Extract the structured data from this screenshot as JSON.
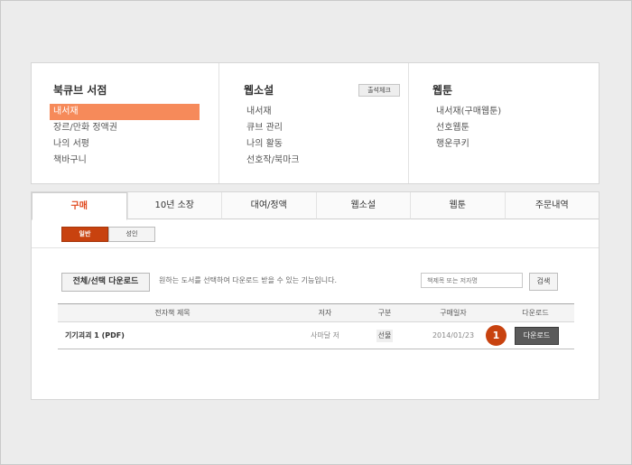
{
  "menu": {
    "bookstore": {
      "title": "북큐브 서점",
      "items": [
        "내서재",
        "장르/만화 정액권",
        "나의 서평",
        "책바구니"
      ]
    },
    "webnovel": {
      "title": "웹소설",
      "attend_button": "출석체크",
      "items": [
        "내서재",
        "큐브 관리",
        "나의 활동",
        "선호작/북마크"
      ]
    },
    "webtoon": {
      "title": "웹툰",
      "items": [
        "내서재(구매웹툰)",
        "선호웹툰",
        "행운쿠키"
      ]
    }
  },
  "tabs": [
    "구매",
    "10년 소장",
    "대여/정액",
    "웹소설",
    "웹툰",
    "주문내역"
  ],
  "subtabs": [
    "일반",
    "성인"
  ],
  "toolbar": {
    "download_all": "전체/선택 다운로드",
    "description": "원하는 도서를 선택하여 다운로드 받을 수 있는 기능입니다.",
    "search_placeholder": "책제목 또는 저자명",
    "search_button": "검색"
  },
  "table": {
    "headers": [
      "전자책 제목",
      "저자",
      "구분",
      "구매일자",
      "다운로드"
    ],
    "rows": [
      {
        "title": "기기괴괴 1 (PDF)",
        "author": "사마달 저",
        "type": "선물",
        "date": "2014/01/23",
        "download": "다운로드"
      }
    ]
  },
  "callout_marker": "1",
  "colors": {
    "accent": "#f68a5a",
    "active_tab": "#e0491e",
    "button_dark": "#5a5a5a",
    "marker": "#c8420f"
  }
}
